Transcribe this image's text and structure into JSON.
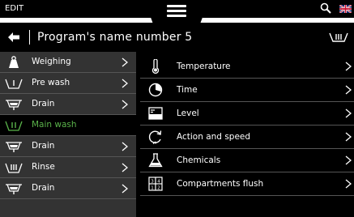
{
  "header": {
    "mode": "EDIT",
    "language_icon": "uk-flag-icon"
  },
  "title": {
    "text": "Program's name number 5"
  },
  "steps": [
    {
      "label": "Weighing",
      "icon": "weighing-icon",
      "selected": false
    },
    {
      "label": "Pre wash",
      "icon": "pre-wash-icon",
      "selected": false
    },
    {
      "label": "Drain",
      "icon": "drain-icon",
      "selected": false
    },
    {
      "label": "Main wash",
      "icon": "main-wash-icon",
      "selected": true
    },
    {
      "label": "Drain",
      "icon": "drain-icon",
      "selected": false
    },
    {
      "label": "Rinse",
      "icon": "rinse-icon",
      "selected": false
    },
    {
      "label": "Drain",
      "icon": "drain-icon",
      "selected": false
    }
  ],
  "parameters": [
    {
      "label": "Temperature",
      "icon": "thermometer-icon"
    },
    {
      "label": "Time",
      "icon": "clock-icon"
    },
    {
      "label": "Level",
      "icon": "level-icon"
    },
    {
      "label": "Action and speed",
      "icon": "rotation-icon"
    },
    {
      "label": "Chemicals",
      "icon": "flask-icon"
    },
    {
      "label": "Compartments flush",
      "icon": "compartments-icon"
    }
  ],
  "colors": {
    "accent": "#5ab34a",
    "panel": "#333333",
    "background": "#000000"
  }
}
